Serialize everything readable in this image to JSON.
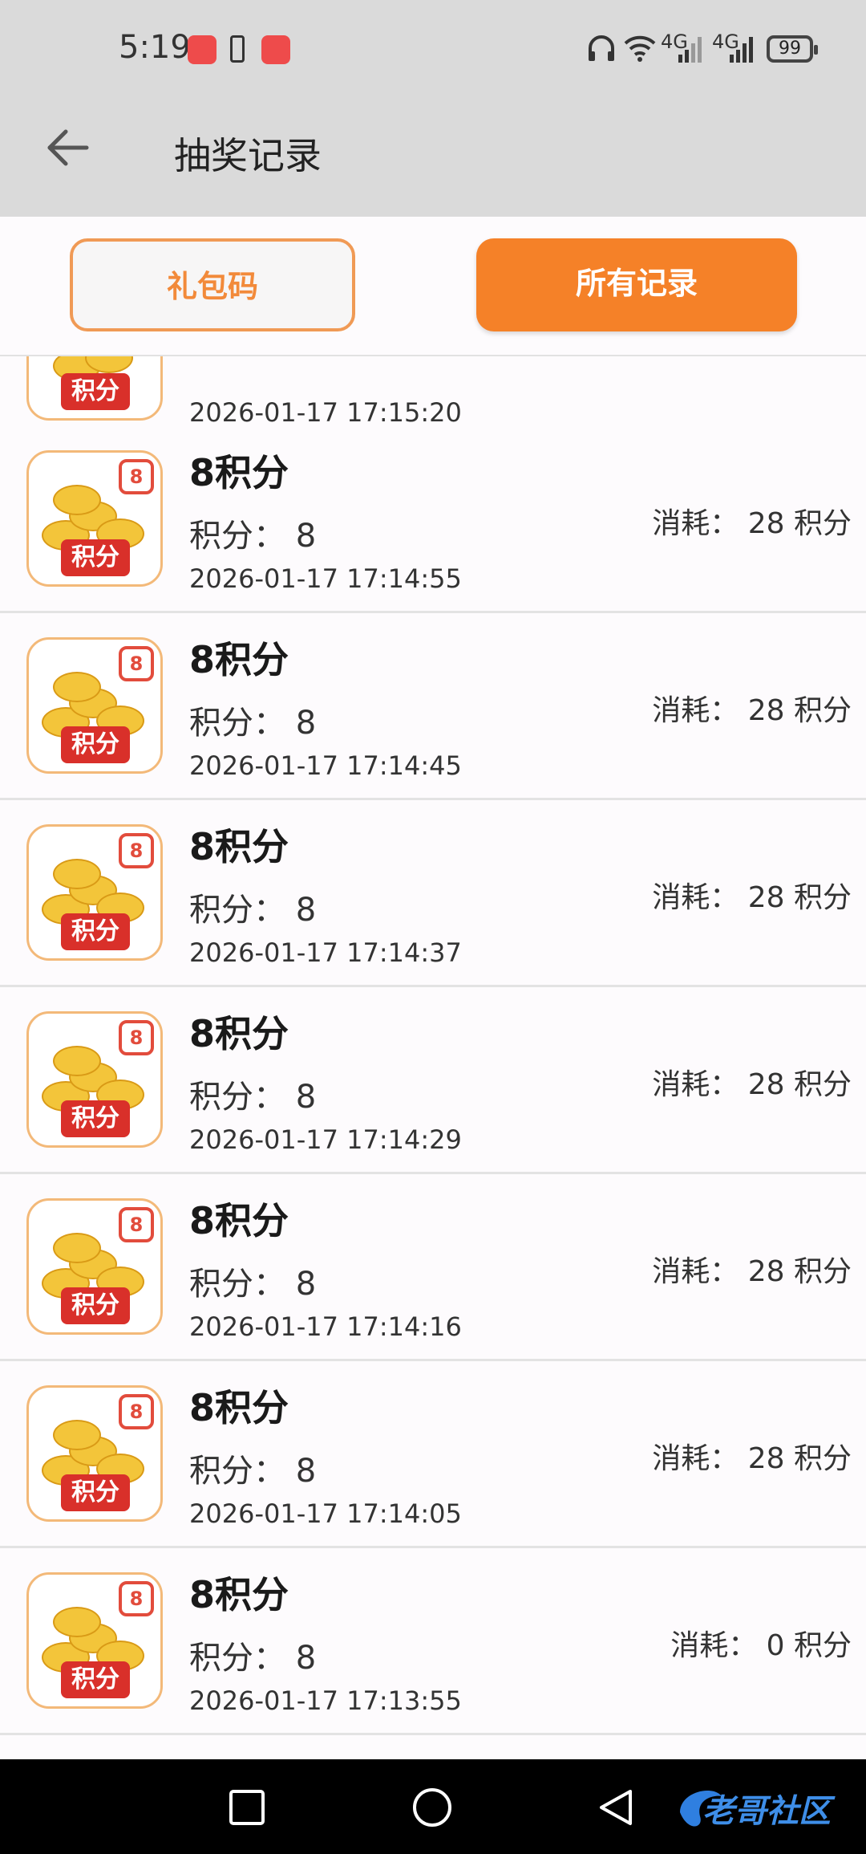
{
  "status_bar": {
    "time": "5:19",
    "battery": "99",
    "network_1": "4G",
    "network_2": "4G"
  },
  "header": {
    "title": "抽奖记录"
  },
  "tabs": {
    "gift_code": "礼包码",
    "all_records": "所有记录"
  },
  "thumbnail": {
    "label": "积分",
    "badge": "8"
  },
  "partial_row": {
    "time": "2026-01-17 17:15:20"
  },
  "records": [
    {
      "name": "8积分",
      "points": "积分：  8",
      "time": "2026-01-17 17:14:55",
      "cost": "消耗：  28 积分"
    },
    {
      "name": "8积分",
      "points": "积分：  8",
      "time": "2026-01-17 17:14:45",
      "cost": "消耗：  28 积分"
    },
    {
      "name": "8积分",
      "points": "积分：  8",
      "time": "2026-01-17 17:14:37",
      "cost": "消耗：  28 积分"
    },
    {
      "name": "8积分",
      "points": "积分：  8",
      "time": "2026-01-17 17:14:29",
      "cost": "消耗：  28 积分"
    },
    {
      "name": "8积分",
      "points": "积分：  8",
      "time": "2026-01-17 17:14:16",
      "cost": "消耗：  28 积分"
    },
    {
      "name": "8积分",
      "points": "积分：  8",
      "time": "2026-01-17 17:14:05",
      "cost": "消耗：  28 积分"
    },
    {
      "name": "8积分",
      "points": "积分：  8",
      "time": "2026-01-17 17:13:55",
      "cost": "消耗：  0 积分"
    }
  ],
  "watermark": {
    "text": "老哥社区"
  }
}
